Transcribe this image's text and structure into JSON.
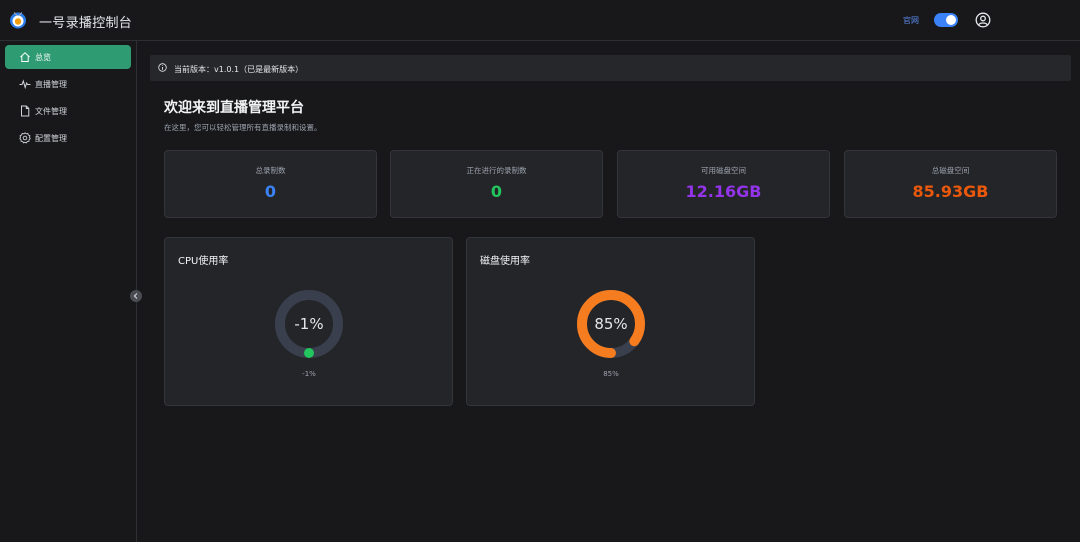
{
  "header": {
    "app_title": "一号录播控制台",
    "official_link": "官网"
  },
  "sidebar": {
    "items": [
      {
        "label": "总览",
        "icon": "home-icon",
        "active": true
      },
      {
        "label": "直播管理",
        "icon": "pulse-icon",
        "active": false
      },
      {
        "label": "文件管理",
        "icon": "file-icon",
        "active": false
      },
      {
        "label": "配置管理",
        "icon": "gear-icon",
        "active": false
      }
    ]
  },
  "version_bar": {
    "text": "当前版本：v1.0.1（已是最新版本）"
  },
  "welcome": {
    "title": "欢迎来到直播管理平台",
    "subtitle": "在这里，您可以轻松管理所有直播录制和设置。"
  },
  "stats": [
    {
      "label": "总录制数",
      "value": "0",
      "color": "#3b82f6"
    },
    {
      "label": "正在进行的录制数",
      "value": "0",
      "color": "#22c55e"
    },
    {
      "label": "可用磁盘空间",
      "value": "12.16GB",
      "color": "#9333ea"
    },
    {
      "label": "总磁盘空间",
      "value": "85.93GB",
      "color": "#ea580c"
    }
  ],
  "gauges": [
    {
      "title": "CPU使用率",
      "center": "-1%",
      "caption": "-1%",
      "percent": -1,
      "color": "#22c55e"
    },
    {
      "title": "磁盘使用率",
      "center": "85%",
      "caption": "85%",
      "percent": 85,
      "color": "#f57c1f"
    }
  ],
  "colors": {
    "accent": "#2f9b73",
    "toggle": "#3b82f6",
    "ring_track": "#3a3f4d"
  }
}
